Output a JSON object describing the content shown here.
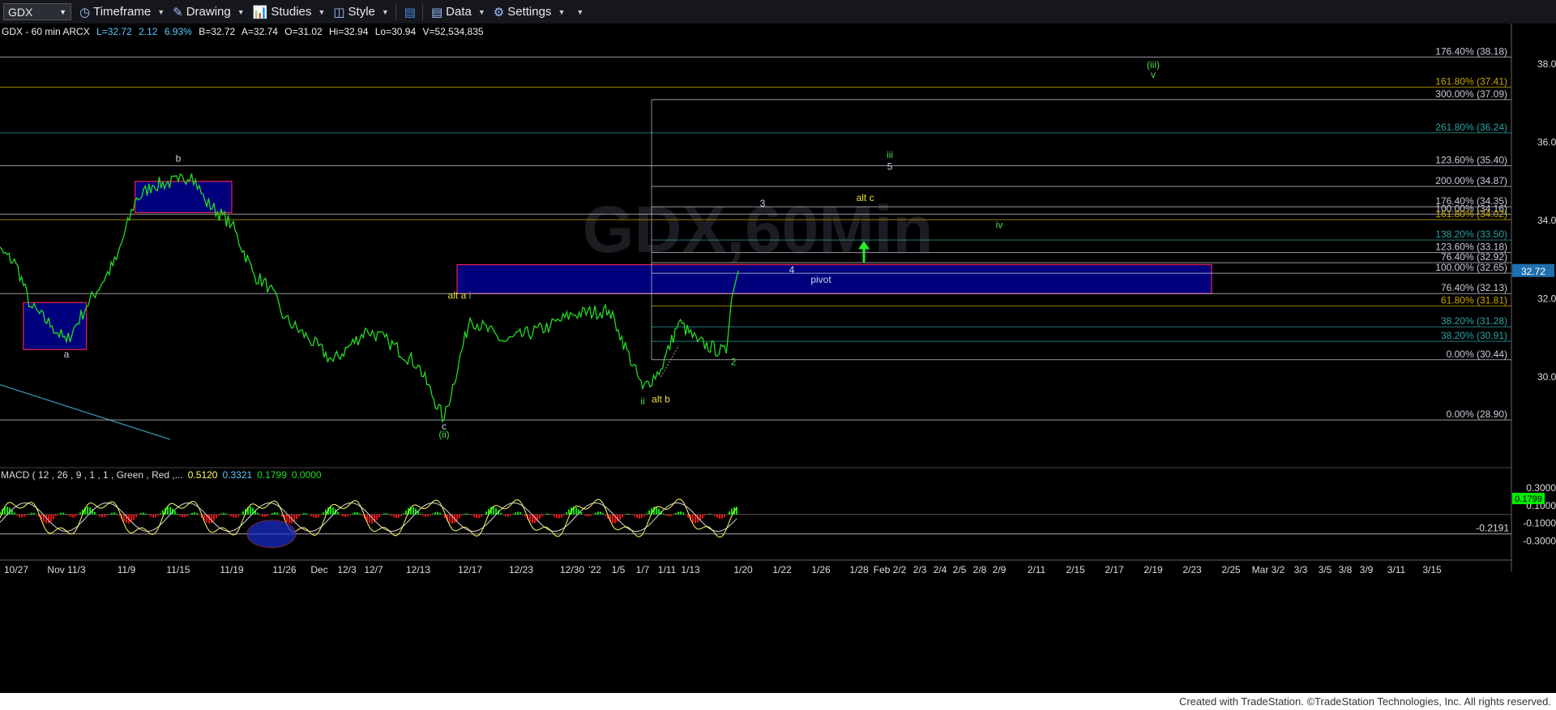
{
  "toolbar": {
    "symbol": "GDX",
    "items": [
      {
        "icon": "clock-icon",
        "label": "Timeframe"
      },
      {
        "icon": "pencil-icon",
        "label": "Drawing"
      },
      {
        "icon": "studies-icon",
        "label": "Studies"
      },
      {
        "icon": "style-icon",
        "label": "Style"
      },
      {
        "icon": "layout-icon",
        "label": ""
      },
      {
        "icon": "data-icon",
        "label": "Data"
      },
      {
        "icon": "gear-icon",
        "label": "Settings"
      }
    ]
  },
  "header": {
    "title": "GDX - 60 min ARCX",
    "last": "L=32.72",
    "change": "2.12",
    "pct": "6.93%",
    "bid": "B=32.72",
    "ask": "A=32.74",
    "open": "O=31.02",
    "high": "Hi=32.94",
    "low": "Lo=30.94",
    "volume": "V=52,534,835"
  },
  "watermark": "GDX,60Min",
  "price_label": "32.72",
  "footer": "Created with TradeStation. ©TradeStation Technologies, Inc. All rights reserved.",
  "colors": {
    "price": "#22dd22",
    "box_fill": "#00008b",
    "box_border": "#ff2a55",
    "fib_light": "#c8ccd8",
    "fib_teal": "#2aa4a4",
    "fib_olive": "#c8a800",
    "macd": "#ffff66",
    "signal": "#d8d8d8",
    "hist_pos": "#00ee00",
    "hist_neg": "#ee1111",
    "arrow": "#22ee22"
  },
  "chart_data": {
    "type": "line",
    "title": "GDX - 60 min ARCX",
    "ylim": [
      28.2,
      38.6
    ],
    "y_ticks": [
      "38.00",
      "36.00",
      "34.00",
      "32.00",
      "30.00"
    ],
    "x_ticks": [
      "10/27",
      "Nov 11/3",
      "11/9",
      "11/15",
      "11/19",
      "11/26",
      "Dec",
      "12/3",
      "12/7",
      "12/13",
      "12/17",
      "12/23",
      "12/30",
      "'22",
      "1/5",
      "1/7",
      "1/11",
      "1/13",
      "1/20",
      "1/22",
      "1/26",
      "1/28",
      "Feb 2/2",
      "2/3",
      "2/4",
      "2/5",
      "2/8",
      "2/9",
      "2/11",
      "2/15",
      "2/17",
      "2/19",
      "2/23",
      "2/25",
      "Mar 3/2",
      "3/3",
      "3/5",
      "3/8",
      "3/9",
      "3/11",
      "3/15"
    ],
    "price_series": [
      {
        "date": "10/25",
        "close": 33.5
      },
      {
        "date": "10/27",
        "close": 32.9
      },
      {
        "date": "10/29",
        "close": 31.8
      },
      {
        "date": "11/1",
        "close": 31.3
      },
      {
        "date": "11/3",
        "close": 30.9
      },
      {
        "date": "11/5",
        "close": 31.8
      },
      {
        "date": "11/8",
        "close": 33.0
      },
      {
        "date": "11/10",
        "close": 34.5
      },
      {
        "date": "11/12",
        "close": 34.9
      },
      {
        "date": "11/15",
        "close": 35.0
      },
      {
        "date": "11/16",
        "close": 35.2
      },
      {
        "date": "11/17",
        "close": 34.5
      },
      {
        "date": "11/19",
        "close": 33.9
      },
      {
        "date": "11/22",
        "close": 32.6
      },
      {
        "date": "11/24",
        "close": 32.3
      },
      {
        "date": "11/26",
        "close": 31.5
      },
      {
        "date": "11/30",
        "close": 31.0
      },
      {
        "date": "12/2",
        "close": 30.4
      },
      {
        "date": "12/6",
        "close": 31.2
      },
      {
        "date": "12/9",
        "close": 30.9
      },
      {
        "date": "12/13",
        "close": 30.3
      },
      {
        "date": "12/15",
        "close": 28.9
      },
      {
        "date": "12/17",
        "close": 31.5
      },
      {
        "date": "12/21",
        "close": 30.9
      },
      {
        "date": "12/27",
        "close": 31.3
      },
      {
        "date": "12/30",
        "close": 31.6
      },
      {
        "date": "1/3",
        "close": 31.7
      },
      {
        "date": "1/5",
        "close": 31.2
      },
      {
        "date": "1/7",
        "close": 29.7
      },
      {
        "date": "1/10",
        "close": 30.2
      },
      {
        "date": "1/12",
        "close": 31.4
      },
      {
        "date": "1/14",
        "close": 30.9
      },
      {
        "date": "1/18",
        "close": 30.6
      },
      {
        "date": "1/19",
        "close": 32.72
      }
    ],
    "fib_levels": [
      {
        "label": "176.40% (38.18)",
        "value": 38.18,
        "color": "light"
      },
      {
        "label": "161.80% (37.41)",
        "value": 37.41,
        "color": "olive"
      },
      {
        "label": "300.00% (37.09)",
        "value": 37.09,
        "color": "light"
      },
      {
        "label": "261.80% (36.24)",
        "value": 36.24,
        "color": "teal"
      },
      {
        "label": "123.60% (35.40)",
        "value": 35.4,
        "color": "light"
      },
      {
        "label": "200.00% (34.87)",
        "value": 34.87,
        "color": "light"
      },
      {
        "label": "176.40% (34.35)",
        "value": 34.35,
        "color": "light"
      },
      {
        "label": "100.00% (34.16)",
        "value": 34.16,
        "color": "light"
      },
      {
        "label": "161.80% (34.02)",
        "value": 34.02,
        "color": "olive"
      },
      {
        "label": "138.20% (33.50)",
        "value": 33.5,
        "color": "teal"
      },
      {
        "label": "123.60% (33.18)",
        "value": 33.18,
        "color": "light"
      },
      {
        "label": "76.40% (32.92)",
        "value": 32.92,
        "color": "light"
      },
      {
        "label": "100.00% (32.65)",
        "value": 32.65,
        "color": "light"
      },
      {
        "label": "76.40% (32.13)",
        "value": 32.13,
        "color": "light"
      },
      {
        "label": "61.80% (31.81)",
        "value": 31.81,
        "color": "olive"
      },
      {
        "label": "38.20% (31.28)",
        "value": 31.28,
        "color": "teal"
      },
      {
        "label": "38.20% (30.91)",
        "value": 30.91,
        "color": "teal"
      },
      {
        "label": "0.00% (30.44)",
        "value": 30.44,
        "color": "light"
      },
      {
        "label": "0.00% (28.90)",
        "value": 28.9,
        "color": "light"
      }
    ],
    "zones": [
      {
        "from": "10/28",
        "to": "11/5",
        "low": 30.7,
        "high": 31.9
      },
      {
        "from": "11/10",
        "to": "11/19",
        "low": 34.2,
        "high": 35.0
      },
      {
        "from": "12/16",
        "to": "2/24",
        "low": 32.13,
        "high": 32.87,
        "label": "pivot"
      }
    ],
    "wave_labels": [
      {
        "text": "a",
        "date": "11/3",
        "value": 30.5,
        "color": "light"
      },
      {
        "text": "b",
        "date": "11/15",
        "value": 35.5,
        "color": "light"
      },
      {
        "text": "c",
        "date": "12/15",
        "value": 28.65,
        "color": "light"
      },
      {
        "text": "(ii)",
        "date": "12/15",
        "value": 28.45,
        "color": "green"
      },
      {
        "text": "alt a",
        "date": "12/16",
        "value": 32.0,
        "color": "yellow"
      },
      {
        "text": "i",
        "date": "12/17",
        "value": 32.0,
        "color": "green"
      },
      {
        "text": "ii",
        "date": "1/7",
        "value": 29.3,
        "color": "green"
      },
      {
        "text": "alt b",
        "date": "1/10",
        "value": 29.35,
        "color": "yellow"
      },
      {
        "text": "2",
        "date": "1/19",
        "value": 30.3,
        "color": "green"
      },
      {
        "text": "3",
        "date": "1/21",
        "value": 34.35,
        "color": "light"
      },
      {
        "text": "4",
        "date": "1/23",
        "value": 32.65,
        "color": "light"
      },
      {
        "text": "pivot",
        "date": "1/26",
        "value": 32.4,
        "color": "light"
      },
      {
        "text": "alt c",
        "date": "1/29",
        "value": 34.5,
        "color": "yellow"
      },
      {
        "text": "iii",
        "date": "2/2",
        "value": 35.6,
        "color": "green"
      },
      {
        "text": "5",
        "date": "2/2",
        "value": 35.3,
        "color": "light"
      },
      {
        "text": "iv",
        "date": "2/9",
        "value": 33.8,
        "color": "green"
      },
      {
        "text": "(iii)",
        "date": "2/19",
        "value": 37.9,
        "color": "green"
      },
      {
        "text": "v",
        "date": "2/19",
        "value": 37.65,
        "color": "green"
      }
    ],
    "macd": {
      "label": "MACD ( 12 , 26 , 9 , 1 , 1 , Green , Red ,...",
      "macd": "0.5120",
      "signal": "0.3321",
      "diff": "0.1799",
      "zero": "0.0000",
      "ylim": [
        -0.35,
        0.4
      ],
      "y_ticks": [
        "0.3000",
        "0.1000",
        "-0.1000",
        "-0.3000"
      ],
      "current": "0.1799",
      "ref_line": "-0.2191",
      "ref_value": -0.2191
    }
  }
}
